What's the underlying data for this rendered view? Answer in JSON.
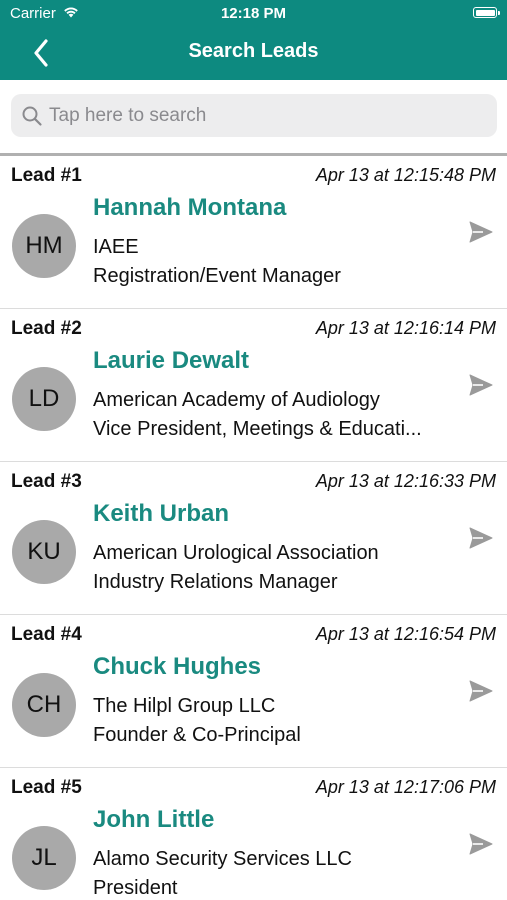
{
  "status_bar": {
    "carrier": "Carrier",
    "time": "12:18 PM",
    "wifi_icon": "wifi-icon",
    "battery_icon": "battery-icon"
  },
  "nav": {
    "title": "Search Leads",
    "back_icon": "chevron-left-icon"
  },
  "search": {
    "placeholder": "Tap here to search",
    "value": "",
    "icon": "search-icon"
  },
  "colors": {
    "brand": "#0d8a80",
    "name_text": "#1a8a80",
    "avatar_bg": "#a9a9a9",
    "send_icon": "#9a9a9a"
  },
  "leads": [
    {
      "number": "Lead #1",
      "timestamp": "Apr 13 at 12:15:48 PM",
      "initials": "HM",
      "name": "Hannah Montana",
      "company": "IAEE",
      "title": "Registration/Event Manager",
      "action_icon": "send-icon"
    },
    {
      "number": "Lead #2",
      "timestamp": "Apr 13 at 12:16:14 PM",
      "initials": "LD",
      "name": "Laurie Dewalt",
      "company": "American Academy of Audiology",
      "title": "Vice President, Meetings & Educati...",
      "action_icon": "send-icon"
    },
    {
      "number": "Lead #3",
      "timestamp": "Apr 13 at 12:16:33 PM",
      "initials": "KU",
      "name": "Keith Urban",
      "company": "American Urological Association",
      "title": "Industry Relations Manager",
      "action_icon": "send-icon"
    },
    {
      "number": "Lead #4",
      "timestamp": "Apr 13 at 12:16:54 PM",
      "initials": "CH",
      "name": "Chuck Hughes",
      "company": "The Hilpl Group LLC",
      "title": "Founder & Co-Principal",
      "action_icon": "send-icon"
    },
    {
      "number": "Lead #5",
      "timestamp": "Apr 13 at 12:17:06 PM",
      "initials": "JL",
      "name": "John Little",
      "company": "Alamo Security Services LLC",
      "title": "President",
      "action_icon": "send-icon"
    }
  ]
}
